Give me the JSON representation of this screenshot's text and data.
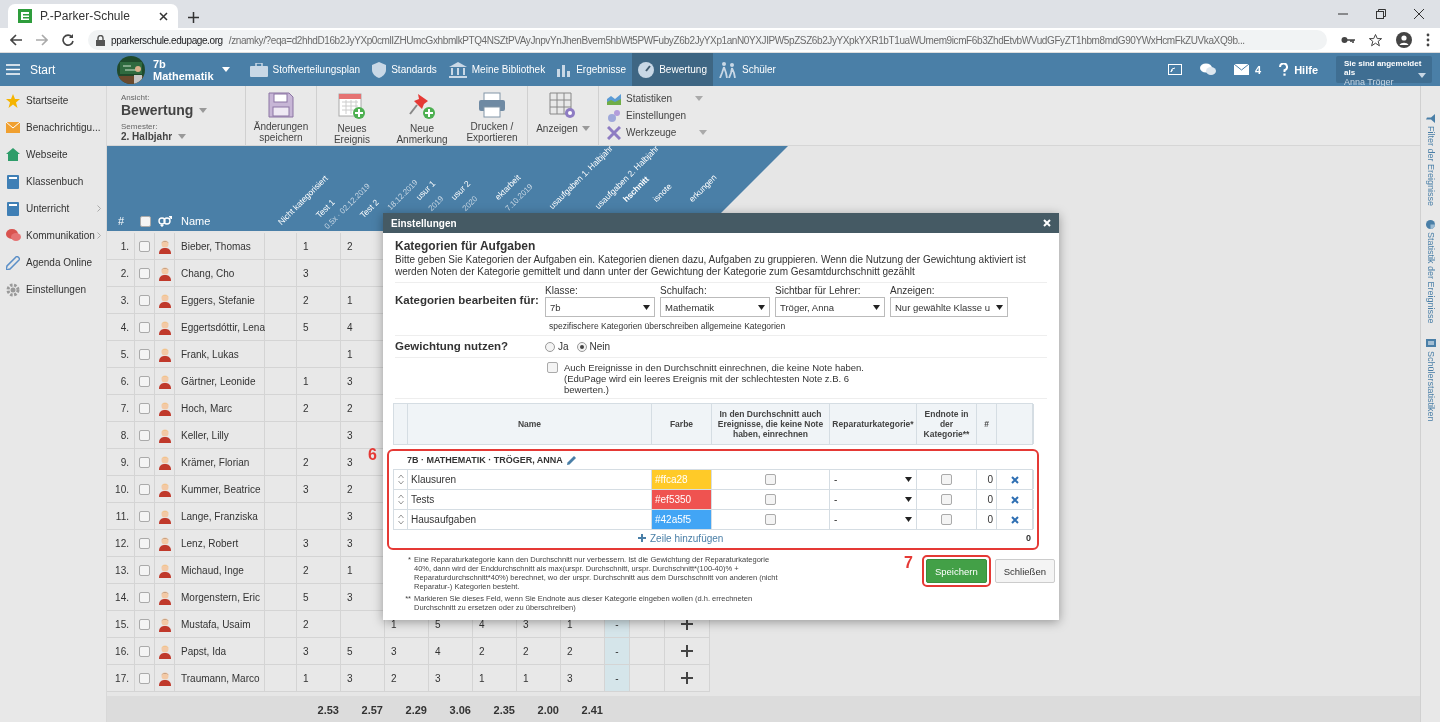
{
  "browser": {
    "tab_title": "P.-Parker-Schule",
    "url_domain": "pparkerschule.edupage.org",
    "url_path": "/znamky/?eqa=d2hhdD16b2JyYXp0cmlIZHUmcGxhbmlkPTQ4NSZtPVAyJnpvYnJhenBvem5hbWt5PWFubyZ6b2JyYXp1anN0YXJIPW5pZSZ6b2JyYXpkYXR1bT1uaWUmem9icmF6b3ZhdEtvbWVudGFyZT1hbm8mdG90YWxHcmFkZUVkaXQ9b..."
  },
  "nav": {
    "start": "Start",
    "class_name": "7b",
    "subject": "Mathematik",
    "items": [
      {
        "label": "Stoffverteilungsplan",
        "kind": "briefcase",
        "selected": false
      },
      {
        "label": "Standards",
        "kind": "shield",
        "selected": false
      },
      {
        "label": "Meine Bibliothek",
        "kind": "library",
        "selected": false
      },
      {
        "label": "Ergebnisse",
        "kind": "bars",
        "selected": false
      },
      {
        "label": "Bewertung",
        "kind": "gauge",
        "selected": true
      },
      {
        "label": "Schüler",
        "kind": "walkers",
        "selected": false
      }
    ],
    "mail_count": "4",
    "help": "Hilfe",
    "login_label": "Sie sind angemeldet als",
    "user": "Anna Tröger"
  },
  "sidebar": {
    "items": [
      {
        "label": "Startseite",
        "kind": "star",
        "expandable": false
      },
      {
        "label": "Benachrichtigu...",
        "kind": "mail",
        "expandable": false
      },
      {
        "label": "Webseite",
        "kind": "house",
        "expandable": false
      },
      {
        "label": "Klassenbuch",
        "kind": "book",
        "expandable": false
      },
      {
        "label": "Unterricht",
        "kind": "book",
        "expandable": true
      },
      {
        "label": "Kommunikation",
        "kind": "chat",
        "expandable": true
      },
      {
        "label": "Agenda Online",
        "kind": "pen",
        "expandable": false
      },
      {
        "label": "Einstellungen",
        "kind": "gear",
        "expandable": false
      }
    ]
  },
  "toolbar": {
    "view_label": "Ansicht:",
    "view": "Bewertung",
    "semester_label": "Semester:",
    "semester": "2. Halbjahr",
    "buttons": [
      {
        "label": "Änderungen speichern",
        "kind": "save"
      },
      {
        "label": "Neues Ereignis",
        "kind": "event"
      },
      {
        "label": "Neue Anmerkung",
        "kind": "pin"
      },
      {
        "label": "Drucken / Exportieren",
        "kind": "print"
      },
      {
        "label": "Anzeigen",
        "kind": "display"
      }
    ],
    "menu": [
      {
        "label": "Statistiken",
        "kind": "chart",
        "dropdown": true
      },
      {
        "label": "Einstellungen",
        "kind": "gears",
        "dropdown": false
      },
      {
        "label": "Werkzeuge",
        "kind": "tools",
        "dropdown": true
      }
    ]
  },
  "side_panel": [
    {
      "label": "Filter der Ereignisse",
      "kind": "filter"
    },
    {
      "label": "Statistik der Ereignisse",
      "kind": "pie"
    },
    {
      "label": "Schülerstatistiken",
      "kind": "doc"
    }
  ],
  "grades": {
    "hash": "#",
    "name": "Name",
    "all_checked": false,
    "columns": [
      {
        "title": "Nicht kategorisiert"
      },
      {
        "title": "Test 1",
        "subtitle": "0.5x · 02.12.2019"
      },
      {
        "title": "Test 2",
        "subtitle": "18.12.2019"
      },
      {
        "title": "usur 1",
        "subtitle": "2019"
      },
      {
        "title": "usur 2",
        "subtitle": "2020"
      },
      {
        "title": "ektarbeit",
        "subtitle": "7.10.2019"
      },
      {
        "title": "usaufgaben 1. Halbjahr"
      },
      {
        "title": "usaufgaben 2. Halbjahr"
      },
      {
        "title": "hschnitt",
        "kind": "average"
      },
      {
        "title": "isnote"
      },
      {
        "title": "erkungen"
      }
    ],
    "rows": [
      {
        "number": "1.",
        "name": "Bieber, Thomas",
        "kind": "dark",
        "checked": false,
        "grades": {
          "column_1": "1",
          "column_2": "2"
        }
      },
      {
        "number": "2.",
        "name": "Chang, Cho",
        "kind": "dark",
        "checked": false,
        "grades": {
          "column_1": "3"
        }
      },
      {
        "number": "3.",
        "name": "Eggers, Stefanie",
        "kind": "blond",
        "checked": false,
        "grades": {
          "column_1": "2",
          "column_2": "1"
        }
      },
      {
        "number": "4.",
        "name": "Eggertsdóttir, Lena",
        "kind": "blond",
        "checked": false,
        "grades": {
          "column_1": "5",
          "column_2": "4"
        }
      },
      {
        "number": "5.",
        "name": "Frank, Lukas",
        "kind": "blond",
        "checked": false,
        "grades": {
          "column_2": "1"
        }
      },
      {
        "number": "6.",
        "name": "Gärtner, Leonide",
        "kind": "blond",
        "checked": false,
        "grades": {
          "column_1": "1",
          "column_2": "3"
        }
      },
      {
        "number": "7.",
        "name": "Hoch, Marc",
        "kind": "blond",
        "checked": false,
        "grades": {
          "column_1": "2",
          "column_2": "2"
        }
      },
      {
        "number": "8.",
        "name": "Keller, Lilly",
        "kind": "blond",
        "checked": false,
        "grades": {
          "column_2": "3"
        }
      },
      {
        "number": "9.",
        "name": "Krämer, Florian",
        "kind": "blond",
        "checked": false,
        "grades": {
          "column_1": "2",
          "column_2": "3"
        }
      },
      {
        "number": "10.",
        "name": "Kummer, Beatrice",
        "kind": "blond",
        "checked": false,
        "grades": {
          "column_1": "3",
          "column_2": "2"
        }
      },
      {
        "number": "11.",
        "name": "Lange, Franziska",
        "kind": "blond",
        "checked": false,
        "grades": {
          "column_2": "3"
        }
      },
      {
        "number": "12.",
        "name": "Lenz, Robert",
        "kind": "dark",
        "checked": false,
        "grades": {
          "column_1": "3",
          "column_2": "3"
        }
      },
      {
        "number": "13.",
        "name": "Michaud, Inge",
        "kind": "blond",
        "checked": false,
        "grades": {
          "column_1": "2",
          "column_2": "1"
        }
      },
      {
        "number": "14.",
        "name": "Morgenstern, Eric",
        "kind": "dark",
        "checked": false,
        "grades": {
          "column_1": "5",
          "column_2": "3"
        }
      },
      {
        "number": "15.",
        "name": "Mustafa, Usaim",
        "kind": "dark",
        "checked": false,
        "grades": {
          "column_1": "2",
          "column_3": "1",
          "column_4": "5",
          "column_5": "4",
          "column_6": "3",
          "column_7": "1"
        },
        "average": "-"
      },
      {
        "number": "16.",
        "name": "Papst, Ida",
        "kind": "blond",
        "checked": false,
        "grades": {
          "column_1": "3",
          "column_2": "5",
          "column_3": "3",
          "column_4": "4",
          "column_5": "2",
          "column_6": "2",
          "column_7": "2"
        },
        "average": "-"
      },
      {
        "number": "17.",
        "name": "Traumann, Marco",
        "kind": "dark",
        "checked": false,
        "grades": {
          "column_1": "1",
          "column_2": "3",
          "column_3": "2",
          "column_4": "3",
          "column_5": "1",
          "column_6": "1",
          "column_7": "3"
        },
        "average": "-"
      }
    ],
    "totals": [
      "2.53",
      "2.57",
      "2.29",
      "3.06",
      "2.35",
      "2.00",
      "2.41"
    ]
  },
  "dialog": {
    "title": "Einstellungen",
    "heading": "Kategorien für Aufgaben",
    "intro": "Bitte geben Sie Kategorien der Aufgaben ein. Kategorien dienen dazu, Aufgaben zu gruppieren. Wenn die Nutzung der Gewichtung aktiviert ist werden Noten der Kategorie gemittelt und dann unter der Gewichtung der Kategorie zum Gesamtdurchschnitt gezählt",
    "edit_for": "Kategorien bearbeiten für:",
    "filters": [
      {
        "label": "Klasse:",
        "value": "7b"
      },
      {
        "label": "Schulfach:",
        "value": "Mathematik"
      },
      {
        "label": "Sichtbar für Lehrer:",
        "value": "Tröger, Anna"
      },
      {
        "label": "Anzeigen:",
        "value": "Nur gewählte Klasse u"
      }
    ],
    "filter_note": "spezifischere Kategorien überschreiben allgemeine Kategorien",
    "weighting": "Gewichtung nutzen?",
    "weighting_options": [
      {
        "label": "Ja",
        "selected": false
      },
      {
        "label": "Nein",
        "selected": true
      }
    ],
    "include_empty": {
      "checked": false,
      "text": "Auch Ereignisse in den Durchschnitt einrechnen, die keine Note haben.",
      "note": "(EduPage wird ein leeres Ereignis mit der schlechtesten Note z.B. 6 bewerten.)"
    },
    "columns": [
      "Name",
      "Farbe",
      "In den Durchschnitt auch Ereignisse, die keine Note haben, einrechnen",
      "Reparaturkategorie*",
      "Endnote in der Kategorie**",
      "#"
    ],
    "group": "7B · MATHEMATIK · TRÖGER, ANNA",
    "categories": [
      {
        "name": "Klausuren",
        "color": "#ffca28",
        "color_text": "#ffca28",
        "include_empty": false,
        "repair": "-",
        "final_grade": false,
        "count": "0"
      },
      {
        "name": "Tests",
        "color": "#ef5350",
        "color_text": "#ef5350",
        "include_empty": false,
        "repair": "-",
        "final_grade": false,
        "count": "0"
      },
      {
        "name": "Hausaufgaben",
        "color": "#42a5f5",
        "color_text": "#42a5f5",
        "include_empty": false,
        "repair": "-",
        "final_grade": false,
        "count": "0"
      }
    ],
    "add_row": "Zeile hinzufügen",
    "total": "0",
    "footnotes": [
      {
        "mark": "*",
        "text": "Eine Reparaturkategorie kann den Durchschnitt nur verbessern. Ist die Gewichtung der Reparaturkategorie 40%, dann wird der Enddurchschnitt als max(urspr. Durchschnitt, urspr. Durchschnitt*(100-40)% + Reparaturdurchschnitt*40%) berechnet, wo der urspr. Durchschnitt aus dem Durschschnitt von anderen (nicht Reparatur-) Kategorien besteht."
      },
      {
        "mark": "**",
        "text": "Markieren Sie dieses Feld, wenn Sie Endnote aus dieser Kategorie eingeben wollen (d.h. errechneten Durchschnitt zu ersetzen oder zu überschreiben)"
      }
    ],
    "buttons": [
      {
        "label": "Speichern",
        "kind": "primary"
      },
      {
        "label": "Schließen",
        "kind": "secondary"
      }
    ],
    "callouts": [
      "6",
      "7"
    ]
  }
}
